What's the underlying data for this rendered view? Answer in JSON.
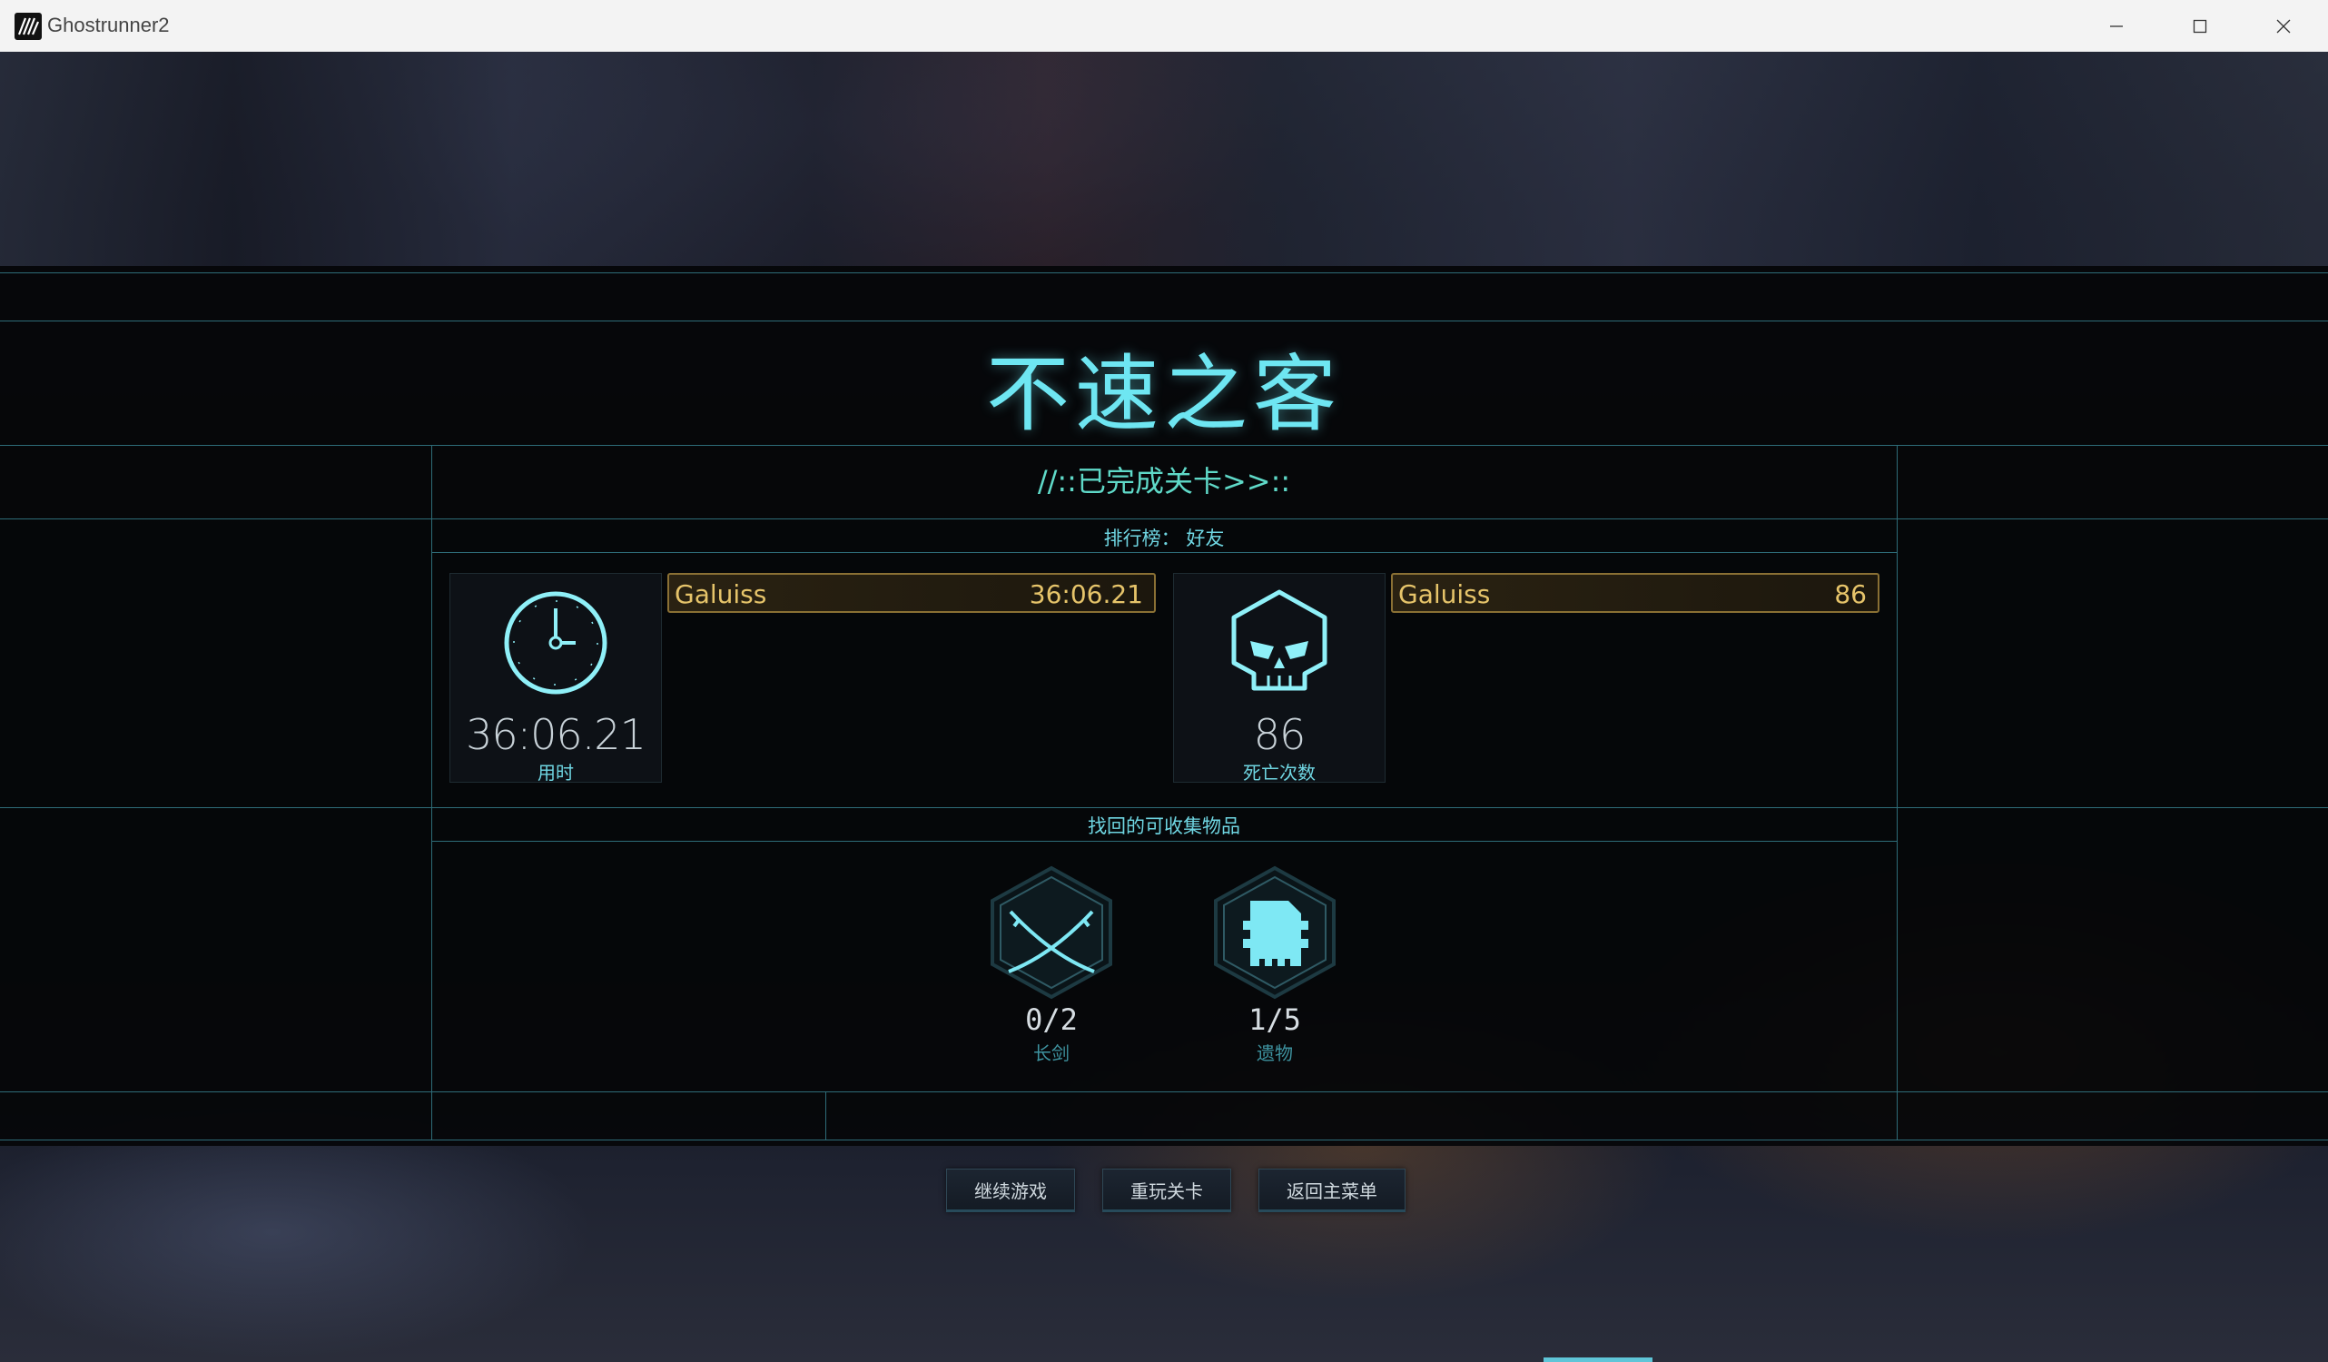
{
  "window": {
    "title": "Ghostrunner2",
    "icon": "ghostrunner-logo-icon"
  },
  "level": {
    "title": "不速之客",
    "subtitle": "//::已完成关卡>>::"
  },
  "leaderboard": {
    "label": "排行榜：  好友",
    "time": {
      "value": "36:06.21",
      "label": "用时",
      "icon": "clock-icon",
      "entry_name": "Galuiss",
      "entry_value": "36:06.21"
    },
    "deaths": {
      "value": "86",
      "label": "死亡次数",
      "icon": "skull-icon",
      "entry_name": "Galuiss",
      "entry_value": "86"
    }
  },
  "collectibles": {
    "label": "找回的可收集物品",
    "items": [
      {
        "count": "0/2",
        "name": "长剑",
        "icon": "crossed-swords-icon"
      },
      {
        "count": "1/5",
        "name": "遗物",
        "icon": "memory-card-icon"
      }
    ]
  },
  "buttons": {
    "continue": "继续游戏",
    "replay": "重玩关卡",
    "main_menu": "返回主菜单"
  },
  "colors": {
    "accent": "#6ee6f2",
    "gold": "#e6c46a",
    "line": "#2e6c78"
  }
}
